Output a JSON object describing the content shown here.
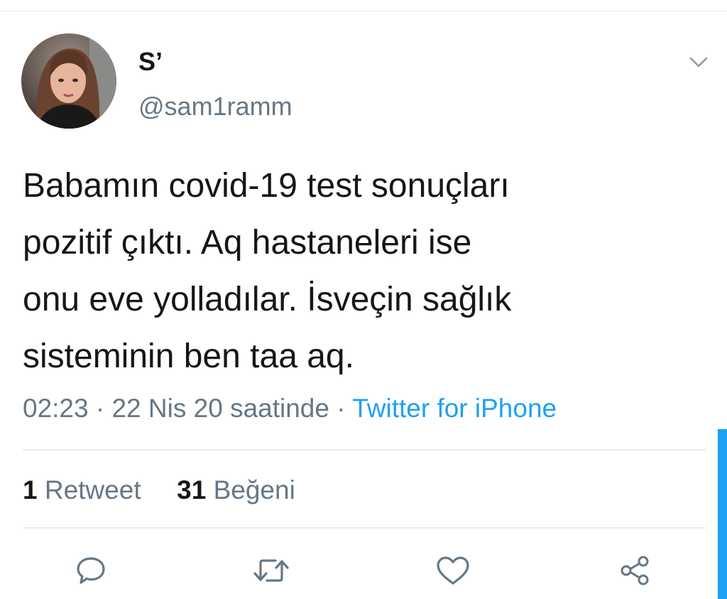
{
  "tweet": {
    "author": {
      "display_name": "S’",
      "handle": "@sam1ramm"
    },
    "text_lines": [
      "Babamın covid-19 test sonuçları",
      "pozitif çıktı. Aq hastaneleri ise",
      "onu eve yolladılar. İsveçin sağlık",
      "sisteminin ben taa aq."
    ],
    "time": "02:23",
    "date": "22 Nis 20 saatinde",
    "separator": "·",
    "source": "Twitter for iPhone"
  },
  "stats": {
    "retweet_count": "1",
    "retweet_label": "Retweet",
    "like_count": "31",
    "like_label": "Beğeni"
  },
  "actions": {
    "reply_icon": "reply-icon",
    "retweet_icon": "retweet-icon",
    "like_icon": "heart-icon",
    "share_icon": "share-icon"
  },
  "colors": {
    "accent": "#1da1f2",
    "secondary_text": "#657786",
    "divider": "#e6ecf0"
  }
}
